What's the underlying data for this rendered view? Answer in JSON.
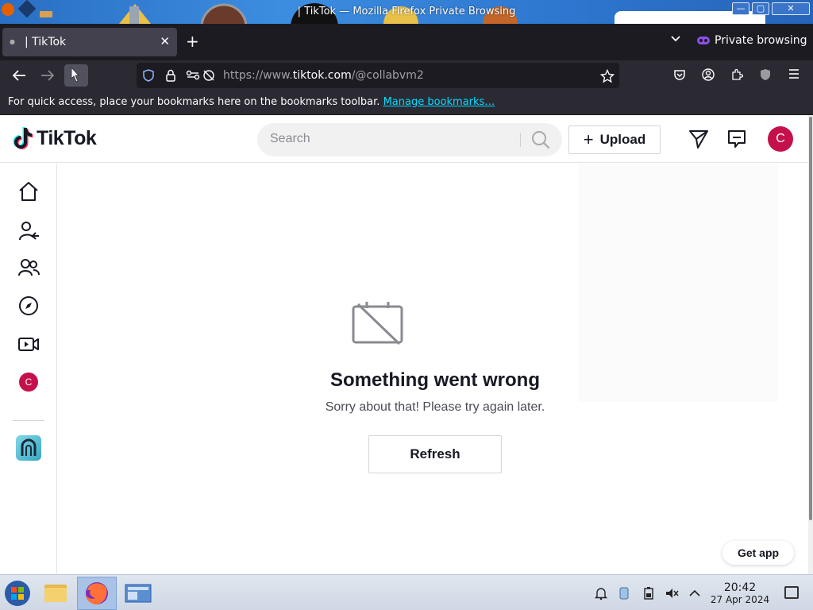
{
  "window": {
    "title": "| TikTok — Mozilla Firefox Private Browsing",
    "buttons": {
      "minimize": "—",
      "maximize": "▢",
      "close": "✕"
    }
  },
  "browser": {
    "tab": {
      "label": "| TikTok",
      "close_icon": "close-icon"
    },
    "new_tab": "+",
    "private_label": "Private browsing",
    "url": {
      "prefix": "https://www.",
      "host": "tiktok.com",
      "path": "/@collabvm2"
    },
    "bookmarks_bar": {
      "text": "For quick access, place your bookmarks here on the bookmarks toolbar.",
      "link": "Manage bookmarks…"
    },
    "accent_link_color": "#00ddff",
    "private_color": "#8c4fe8"
  },
  "tiktok": {
    "logo_text": "TikTok",
    "search": {
      "placeholder": "Search"
    },
    "upload_label": "Upload",
    "avatar_letter": "C",
    "brand_color": "#c4114b",
    "sidebar": {
      "items": [
        {
          "name": "home",
          "icon": "home-icon"
        },
        {
          "name": "following",
          "icon": "user-follow-icon"
        },
        {
          "name": "friends",
          "icon": "friends-icon"
        },
        {
          "name": "explore",
          "icon": "compass-icon"
        },
        {
          "name": "live",
          "icon": "video-camera-icon"
        },
        {
          "name": "profile",
          "icon": "avatar"
        }
      ],
      "avatar_letter": "C"
    },
    "error": {
      "title": "Something went wrong",
      "subtitle": "Sorry about that! Please try again later.",
      "button": "Refresh"
    },
    "get_app": "Get app"
  },
  "taskbar": {
    "clock": {
      "time": "20:42",
      "date": "27 Apr 2024"
    },
    "apps": [
      "start-menu",
      "file-manager",
      "firefox",
      "control-panel"
    ]
  }
}
